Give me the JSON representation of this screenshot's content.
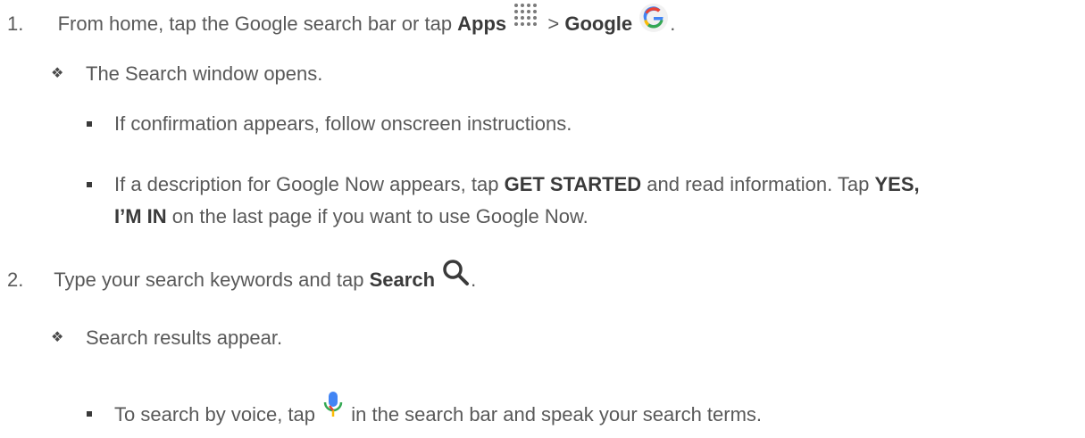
{
  "step1": {
    "number": "1.",
    "text_a": "From home, tap the Google search bar or tap ",
    "apps": "Apps",
    "gt": " > ",
    "google": "Google",
    "end": "."
  },
  "step1_sub": {
    "bullet": "❖",
    "text": "The Search window opens."
  },
  "step1_items": [
    {
      "text": "If confirmation appears, follow onscreen instructions."
    },
    {
      "a": "If a description for Google Now appears, tap ",
      "b1": "GET STARTED",
      "c": " and read information. Tap ",
      "b2": "YES,",
      "d": "I’M IN",
      "e": "  on the last page if you want to use Google Now."
    }
  ],
  "step2": {
    "number": "2.",
    "text_a": "Type your search keywords and tap ",
    "search": "Search",
    "end": "."
  },
  "step2_sub": {
    "bullet": "❖",
    "text": "Search results appear."
  },
  "step2_items": [
    {
      "a": "To search by voice, tap ",
      "b": " in the search bar and speak your search terms."
    }
  ],
  "icons": {
    "apps": "apps-grid-icon",
    "google": "google-g-icon",
    "search": "magnifier-icon",
    "mic": "microphone-icon"
  }
}
